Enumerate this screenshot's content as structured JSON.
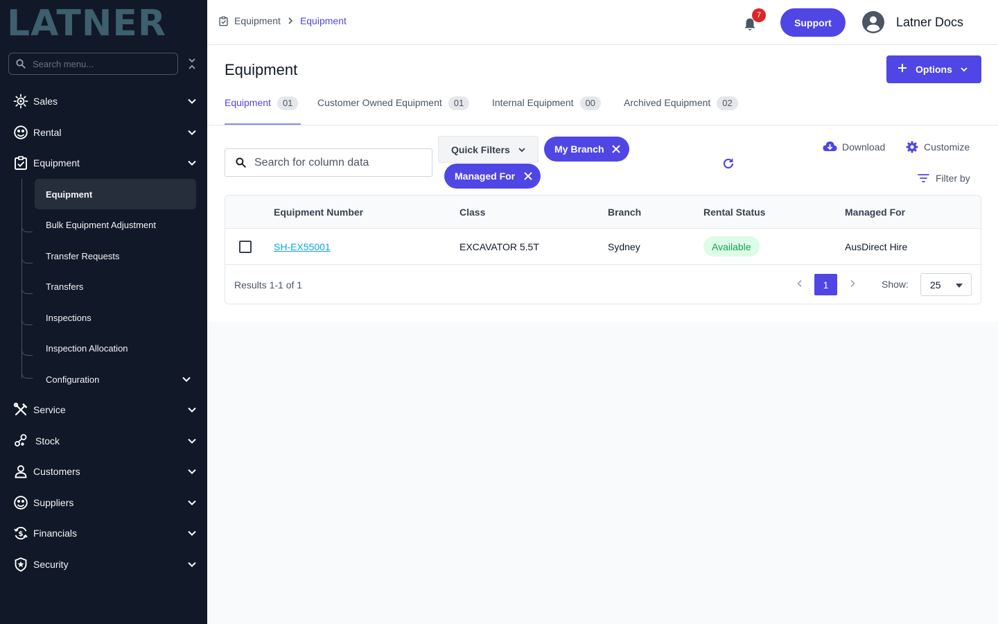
{
  "brand": {
    "logo_text": "LATNER"
  },
  "sidebar": {
    "search_placeholder": "Search menu...",
    "items": [
      {
        "label": "Sales",
        "icon": "sales-icon"
      },
      {
        "label": "Rental",
        "icon": "rental-icon"
      },
      {
        "label": "Equipment",
        "icon": "equipment-icon"
      },
      {
        "label": "Service",
        "icon": "service-icon"
      },
      {
        "label": "Stock",
        "icon": "stock-icon"
      },
      {
        "label": "Customers",
        "icon": "customers-icon"
      },
      {
        "label": "Suppliers",
        "icon": "suppliers-icon"
      },
      {
        "label": "Financials",
        "icon": "financials-icon"
      },
      {
        "label": "Security",
        "icon": "security-icon"
      }
    ],
    "equipment_sub": [
      {
        "label": "Equipment",
        "active": true
      },
      {
        "label": "Bulk Equipment Adjustment"
      },
      {
        "label": "Transfer Requests"
      },
      {
        "label": "Transfers"
      },
      {
        "label": "Inspections"
      },
      {
        "label": "Inspection Allocation"
      },
      {
        "label": "Configuration"
      }
    ]
  },
  "header": {
    "breadcrumb": [
      "Equipment",
      "Equipment"
    ],
    "notification_count": "7",
    "support_label": "Support",
    "user_name": "Latner Docs"
  },
  "page": {
    "title": "Equipment",
    "options_label": "Options",
    "tabs": [
      {
        "label": "Equipment",
        "count": "01",
        "active": true
      },
      {
        "label": "Customer Owned Equipment",
        "count": "01"
      },
      {
        "label": "Internal Equipment",
        "count": "00"
      },
      {
        "label": "Archived Equipment",
        "count": "02"
      }
    ]
  },
  "toolbar": {
    "search_placeholder": "Search for column data",
    "quick_filters_label": "Quick Filters",
    "chips": [
      "My Branch",
      "Managed For"
    ],
    "download_label": "Download",
    "customize_label": "Customize",
    "filter_by_label": "Filter by"
  },
  "table": {
    "columns": [
      "Equipment Number",
      "Class",
      "Branch",
      "Rental Status",
      "Managed For"
    ],
    "rows": [
      {
        "equipment_number": "SH-EX55001",
        "class": "EXCAVATOR 5.5T",
        "branch": "Sydney",
        "rental_status": "Available",
        "managed_for": "AusDirect Hire"
      }
    ],
    "results_text": "Results 1-1 of 1",
    "current_page": "1",
    "show_label": "Show:",
    "page_size": "25"
  },
  "colors": {
    "sidebar_bg": "#111827",
    "accent": "#4f46e5",
    "logo": "#3d5f6e",
    "status_available": "#16a34a",
    "badge_red": "#dc2626"
  }
}
